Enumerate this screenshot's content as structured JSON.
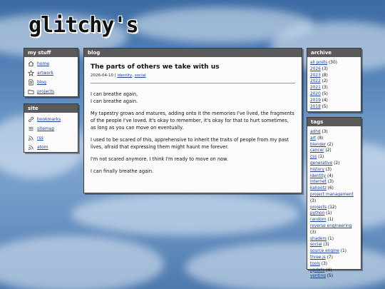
{
  "logo": "glitchy's",
  "my_stuff": {
    "title": "my stuff",
    "items": [
      {
        "label": "home",
        "icon": "home-icon"
      },
      {
        "label": "artwork",
        "icon": "star-icon"
      },
      {
        "label": "blog",
        "icon": "document-icon"
      },
      {
        "label": "projects",
        "icon": "folder-icon"
      }
    ]
  },
  "site": {
    "title": "site",
    "items": [
      {
        "label": "bookmarks",
        "icon": "link-icon"
      },
      {
        "label": "sitemap",
        "icon": "sitemap-icon"
      },
      {
        "label": "rss",
        "icon": "rss-icon"
      },
      {
        "label": "atom",
        "icon": "rss-icon"
      }
    ]
  },
  "blog": {
    "header": "blog",
    "title": "The parts of others we take with us",
    "date": "2026-04-10",
    "sep": "|",
    "tags": [
      "identity",
      "social"
    ],
    "tag_sep": ",",
    "paragraphs": [
      [
        "I can breathe again,",
        "I can breathe again."
      ],
      [
        "My tapestry grows and matures, adding onto it the memories I've lived, the fragments of the people I've loved. It's okay to remember, it's okay for that to hurt sometimes, as long as you can move on eventually."
      ],
      [
        "I used to be scared of this, apprehensive to inherit the traits of people from my past lives, afraid that expressing them might haunt me forever."
      ],
      [
        "I'm not scared anymore. I think I'm ready to move on now."
      ],
      [
        "I can finally breathe again."
      ]
    ]
  },
  "archive": {
    "title": "archive",
    "items": [
      {
        "label": "all posts",
        "count": "(30)"
      },
      {
        "label": "2026",
        "count": "(3)"
      },
      {
        "label": "2023",
        "count": "(8)"
      },
      {
        "label": "2022",
        "count": "(2)"
      },
      {
        "label": "2021",
        "count": "(3)"
      },
      {
        "label": "2020",
        "count": "(5)"
      },
      {
        "label": "2019",
        "count": "(4)"
      },
      {
        "label": "2018",
        "count": "(5)"
      }
    ]
  },
  "tags": {
    "title": "tags",
    "items": [
      {
        "label": "adhd",
        "count": "(3)"
      },
      {
        "label": "art",
        "count": "(8)"
      },
      {
        "label": "blender",
        "count": "(2)"
      },
      {
        "label": "cancer",
        "count": "(2)"
      },
      {
        "label": "css",
        "count": "(1)"
      },
      {
        "label": "generative",
        "count": "(2)"
      },
      {
        "label": "history",
        "count": "(3)"
      },
      {
        "label": "identity",
        "count": "(4)"
      },
      {
        "label": "internet",
        "count": "(3)"
      },
      {
        "label": "kahootz",
        "count": "(6)"
      },
      {
        "label": "project management",
        "count": "(3)"
      },
      {
        "label": "projects",
        "count": "(12)"
      },
      {
        "label": "python",
        "count": "(1)"
      },
      {
        "label": "random",
        "count": "(1)"
      },
      {
        "label": "reverse engineering",
        "count": "(3)"
      },
      {
        "label": "shaders",
        "count": "(1)"
      },
      {
        "label": "social",
        "count": "(3)"
      },
      {
        "label": "source engine",
        "count": "(1)"
      },
      {
        "label": "three.js",
        "count": "(7)"
      },
      {
        "label": "tools",
        "count": "(3)"
      },
      {
        "label": "update",
        "count": "(4)"
      },
      {
        "label": "venting",
        "count": "(5)"
      }
    ]
  }
}
